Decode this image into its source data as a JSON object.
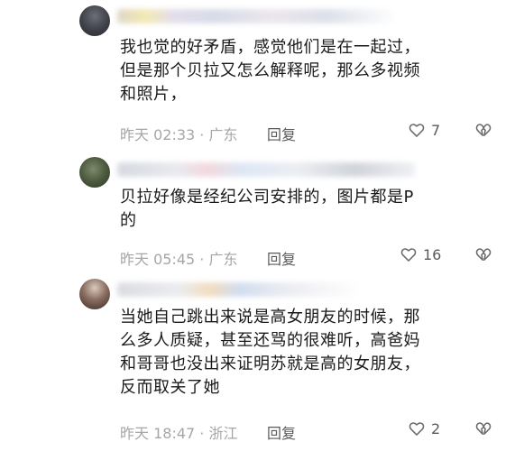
{
  "comments": [
    {
      "text": "我也觉的好矛盾，感觉他们是在一起过，\n但是那个贝拉又怎么解释呢，那么多视频\n和照片，",
      "time": "昨天 02:33 · 广东",
      "reply_label": "回复",
      "likes": "7",
      "like_icon": "heart-outline-icon",
      "dislike_icon": "broken-heart-icon"
    },
    {
      "text": "贝拉好像是经纪公司安排的，图片都是P\n的",
      "time": "昨天 05:45 · 广东",
      "reply_label": "回复",
      "likes": "16",
      "like_icon": "heart-outline-icon",
      "dislike_icon": "broken-heart-icon"
    },
    {
      "text": "当她自己跳出来说是高女朋友的时候，那\n么多人质疑，甚至还骂的很难听，高爸妈\n和哥哥也没出来证明苏就是高的女朋友，\n反而取关了她",
      "time": "昨天 18:47 · 浙江",
      "reply_label": "回复",
      "likes": "2",
      "like_icon": "heart-outline-icon",
      "dislike_icon": "broken-heart-icon"
    }
  ],
  "colors": {
    "text": "#1a1a1a",
    "meta": "#a6a6a6",
    "action": "#5a5a5a"
  }
}
